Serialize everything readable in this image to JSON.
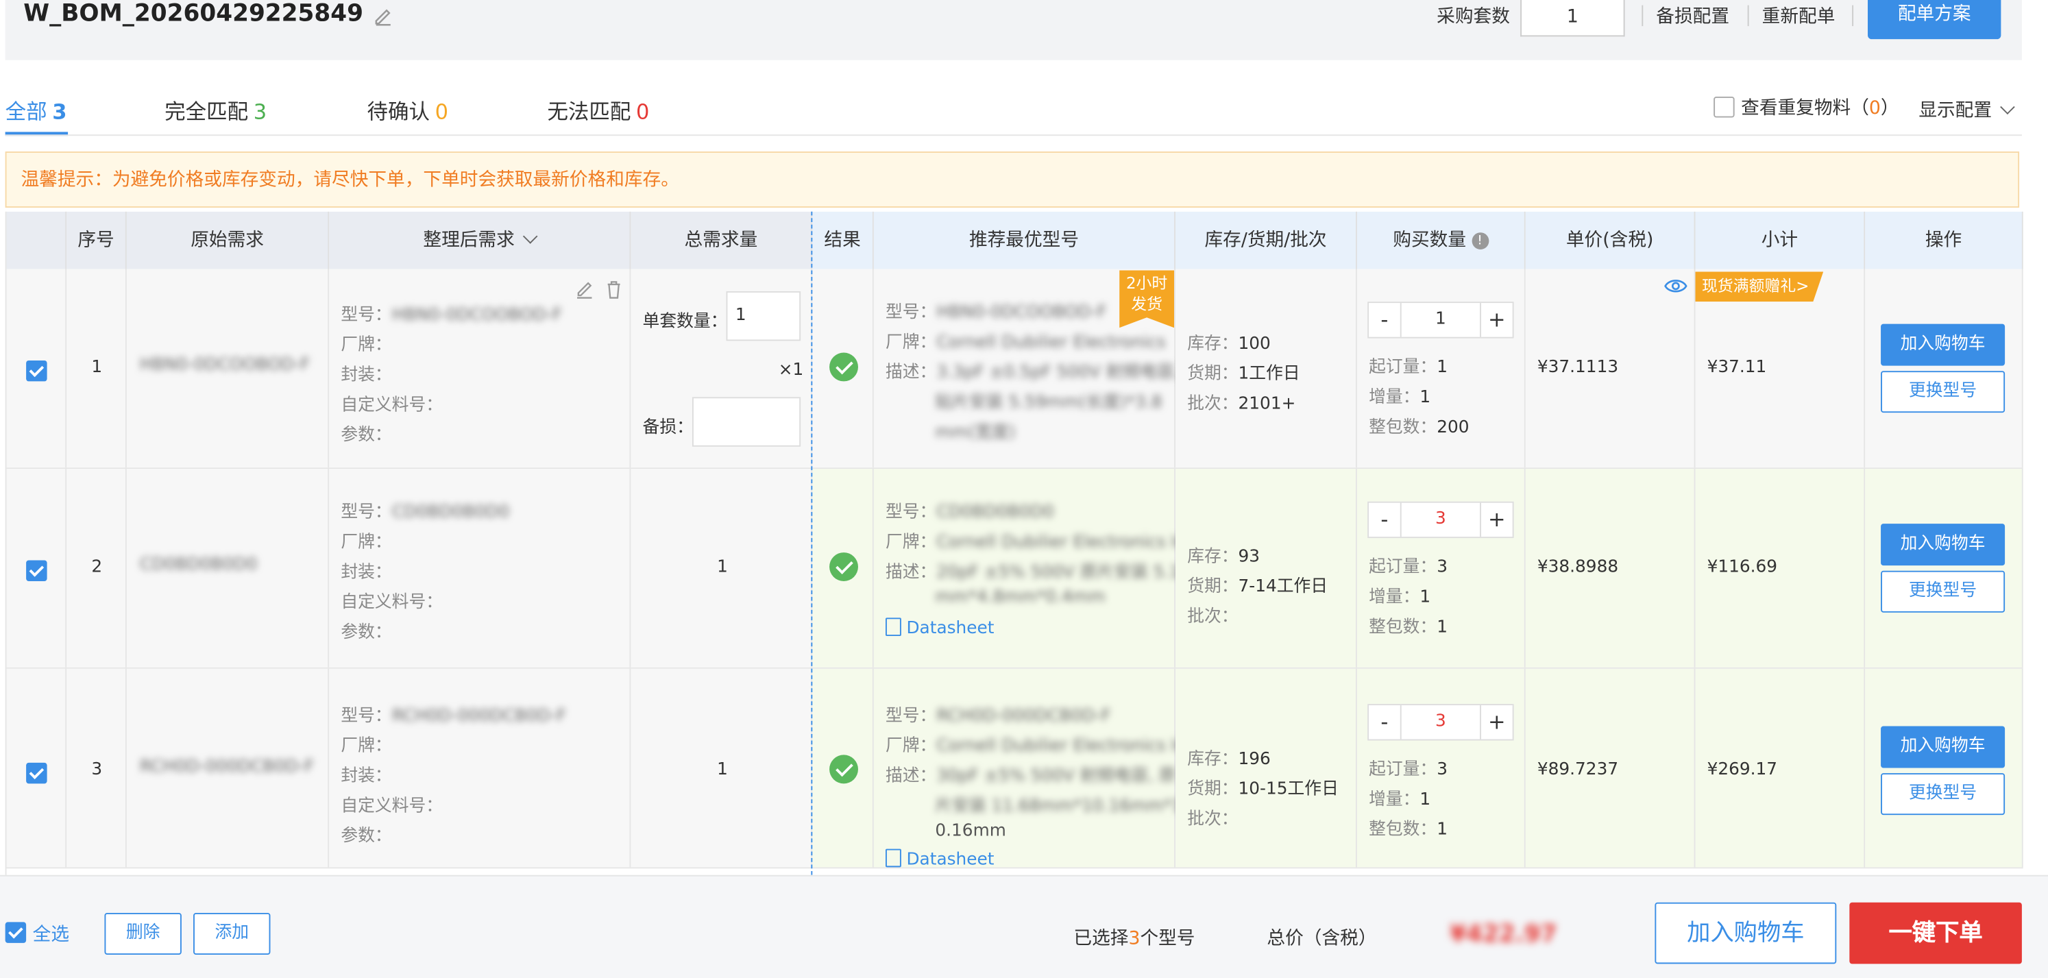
{
  "header": {
    "title": "W_BOM_20260429225849",
    "buy_sets_label": "采购套数",
    "buy_sets_value": "1",
    "spare_config": "备损配置",
    "rematch": "重新配单",
    "plan_button": "配单方案"
  },
  "tabs": [
    {
      "label": "全部",
      "count": "3",
      "color": "#3a8ee6"
    },
    {
      "label": "完全匹配",
      "count": "3",
      "color": "#4caf50"
    },
    {
      "label": "待确认",
      "count": "0",
      "color": "#f5a623"
    },
    {
      "label": "无法匹配",
      "count": "0",
      "color": "#e53935"
    }
  ],
  "toolbar": {
    "dup_label": "查看重复物料",
    "dup_count": "0",
    "display_config": "显示配置"
  },
  "notice": "温馨提示：为避免价格或库存变动，请尽快下单，下单时会获取最新价格和库存。",
  "table": {
    "columns": [
      "序号",
      "原始需求",
      "整理后需求",
      "总需求量",
      "结果",
      "推荐最优型号",
      "库存/货期/批次",
      "购买数量",
      "单价(含税)",
      "小计",
      "操作"
    ],
    "labels": {
      "model": "型号：",
      "brand": "厂牌：",
      "package": "封装：",
      "custom": "自定义料号：",
      "params": "参数：",
      "unit_qty": "单套数量：",
      "spare": "备损：",
      "desc": "描述：",
      "stock": "库存：",
      "lead": "货期：",
      "batch": "批次：",
      "moq": "起订量：",
      "step": "增量：",
      "pack": "整包数：",
      "datasheet": "Datasheet",
      "add_cart": "加入购物车",
      "change_model": "更换型号",
      "fast_ship": "2小时发货",
      "gift": "现货满额赠礼>"
    },
    "rows": [
      {
        "idx": "1",
        "raw": "HBN0-0DCOOBOD-F",
        "model": "HBN0-0DCOOBOD-F",
        "unit_qty": "1",
        "multiplier": "×1",
        "rec_model": "HBN0-0DCOOBOD-F",
        "rec_brand": "Cornell Dubilier Electronics",
        "rec_desc1": "3.3pF ±0.5pF 500V 射频电容,",
        "rec_desc2": "贴片安装 5.59mm(长度)*3.8",
        "rec_desc3": "mm(宽度)",
        "stock": "100",
        "lead": "1工作日",
        "batch": "2101+",
        "qty": "1",
        "qty_red": false,
        "moq": "1",
        "step": "1",
        "pack": "200",
        "price": "¥37.1113",
        "subtotal": "¥37.11"
      },
      {
        "idx": "2",
        "raw": "CD0BD0B0D0",
        "model": "CD0BD0B0D0",
        "total": "1",
        "rec_model": "CD0BD0B0D0",
        "rec_brand": "Cornell Dubilier Electronics Inc",
        "rec_desc1": "20pF ±5% 500V 原片安装 5.1",
        "rec_desc2": "mm*4.8mm*0.4mm",
        "stock": "93",
        "lead": "7-14工作日",
        "batch": "",
        "qty": "3",
        "qty_red": true,
        "moq": "3",
        "step": "1",
        "pack": "1",
        "price": "¥38.8988",
        "subtotal": "¥116.69"
      },
      {
        "idx": "3",
        "raw": "RCH0D-000DCB0D-F",
        "model": "RCH0D-000DCB0D-F",
        "total": "1",
        "rec_model": "RCH0D-000DCB0D-F",
        "rec_brand": "Cornell Dubilier Electronics Inc",
        "rec_desc1": "30pF ±5% 500V 射频电容, 原",
        "rec_desc2": "片安装 11.68mm*10.16mm*1.",
        "rec_desc3": "0.16mm",
        "stock": "196",
        "lead": "10-15工作日",
        "batch": "",
        "qty": "3",
        "qty_red": true,
        "moq": "3",
        "step": "1",
        "pack": "1",
        "price": "¥89.7237",
        "subtotal": "¥269.17"
      }
    ]
  },
  "footer": {
    "select_all": "全选",
    "delete": "删除",
    "add": "添加",
    "selected_prefix": "已选择",
    "selected_count": "3",
    "selected_suffix": "个型号",
    "total_label": "总价（含税）",
    "total_amount": "¥422.97",
    "add_cart": "加入购物车",
    "one_click_order": "一键下单"
  }
}
